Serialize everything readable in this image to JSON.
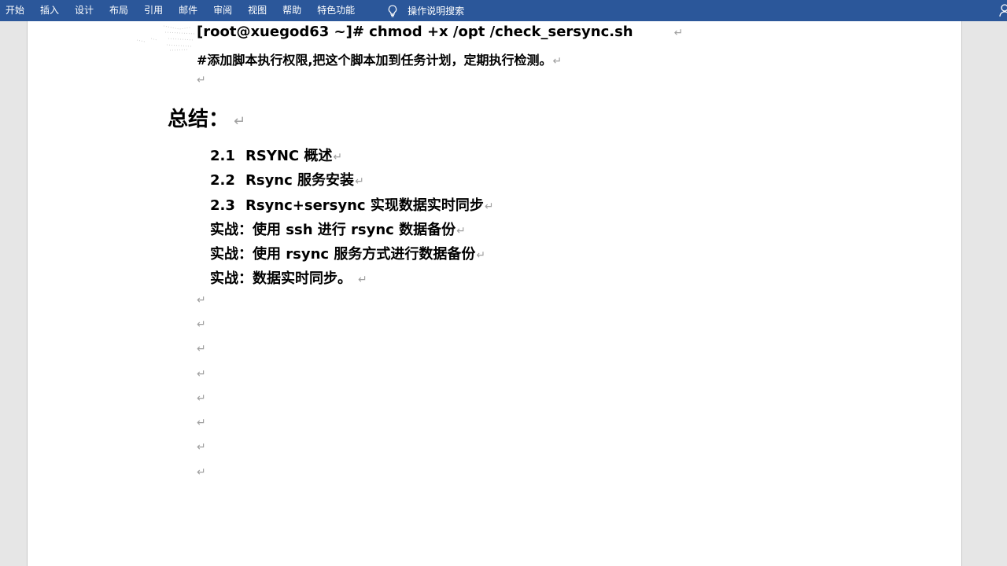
{
  "ribbon": {
    "tabs": [
      "开始",
      "插入",
      "设计",
      "布局",
      "引用",
      "邮件",
      "审阅",
      "视图",
      "帮助",
      "特色功能"
    ],
    "tell_me": "操作说明搜索"
  },
  "document": {
    "command": "[root@xuegod63 ~]# chmod +x /opt /check_sersync.sh",
    "comment": "#添加脚本执行权限,把这个脚本加到任务计划，定期执行检测。",
    "heading": "总结：",
    "items": [
      {
        "num": "2.1",
        "text": "RSYNC 概述"
      },
      {
        "num": "2.2",
        "text": "Rsync 服务安装"
      },
      {
        "num": "2.3",
        "text": "Rsync+sersync 实现数据实时同步"
      }
    ],
    "practices": [
      "实战：使用 ssh 进行 rsync 数据备份",
      "实战：使用 rsync 服务方式进行数据备份",
      "实战：数据实时同步。"
    ],
    "paragraph_mark": "↵"
  },
  "colors": {
    "ribbon_bg": "#2b579a",
    "page_bg": "#ffffff",
    "paragraph_mark": "#a0a0a0"
  }
}
